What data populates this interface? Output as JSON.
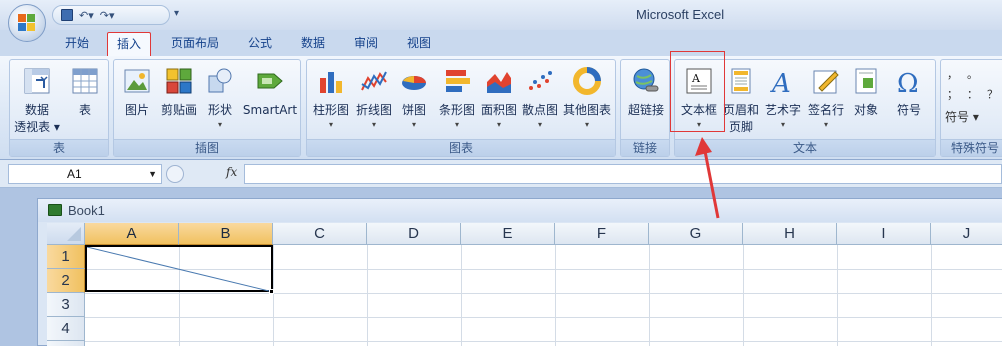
{
  "window": {
    "title": "Microsoft Excel"
  },
  "quick_access": {
    "dropdown_glyph": "▾"
  },
  "tabs": [
    {
      "label": "开始",
      "active": false
    },
    {
      "label": "插入",
      "active": true
    },
    {
      "label": "页面布局",
      "active": false
    },
    {
      "label": "公式",
      "active": false
    },
    {
      "label": "数据",
      "active": false
    },
    {
      "label": "审阅",
      "active": false
    },
    {
      "label": "视图",
      "active": false
    }
  ],
  "ribbon": {
    "groups": {
      "table": {
        "title": "表",
        "buttons": [
          {
            "label1": "数据",
            "label2": "透视表 ▾",
            "icon": "pivot-table-icon"
          },
          {
            "label1": "表",
            "label2": "",
            "icon": "table-icon"
          }
        ]
      },
      "illustrations": {
        "title": "插图",
        "buttons": [
          {
            "label1": "图片",
            "icon": "picture-icon"
          },
          {
            "label1": "剪贴画",
            "icon": "clipart-icon"
          },
          {
            "label1": "形状",
            "icon": "shapes-icon",
            "dropdown": true
          },
          {
            "label1": "SmartArt",
            "icon": "smartart-icon"
          }
        ]
      },
      "charts": {
        "title": "图表",
        "buttons": [
          {
            "label1": "柱形图",
            "icon": "column-chart-icon"
          },
          {
            "label1": "折线图",
            "icon": "line-chart-icon"
          },
          {
            "label1": "饼图",
            "icon": "pie-chart-icon"
          },
          {
            "label1": "条形图",
            "icon": "bar-chart-icon"
          },
          {
            "label1": "面积图",
            "icon": "area-chart-icon"
          },
          {
            "label1": "散点图",
            "icon": "scatter-chart-icon"
          },
          {
            "label1": "其他图表",
            "icon": "other-charts-icon"
          }
        ]
      },
      "links": {
        "title": "链接",
        "buttons": [
          {
            "label1": "超链接",
            "icon": "hyperlink-icon"
          }
        ]
      },
      "text": {
        "title": "文本",
        "buttons": [
          {
            "label1": "文本框",
            "icon": "textbox-icon",
            "dropdown": true
          },
          {
            "label1": "页眉和",
            "label2": "页脚",
            "icon": "header-footer-icon"
          },
          {
            "label1": "艺术字",
            "icon": "wordart-icon",
            "dropdown": true
          },
          {
            "label1": "签名行",
            "icon": "signature-line-icon",
            "dropdown": true
          },
          {
            "label1": "对象",
            "icon": "object-icon"
          },
          {
            "label1": "符号",
            "icon": "symbol-icon"
          }
        ]
      },
      "special_symbols": {
        "title": "特殊符号",
        "symbols": [
          "，",
          "。",
          "；",
          "：",
          "？"
        ],
        "button_label": "符号 ▾"
      }
    }
  },
  "formula_bar": {
    "cell_ref": "A1",
    "fx_label": "fx",
    "value": ""
  },
  "workbook": {
    "name": "Book1",
    "columns": [
      "A",
      "B",
      "C",
      "D",
      "E",
      "F",
      "G",
      "H",
      "I",
      "J"
    ],
    "rows": [
      "1",
      "2",
      "3",
      "4"
    ],
    "selected_columns": [
      "A",
      "B"
    ],
    "selected_rows": [
      "1",
      "2"
    ]
  },
  "colors": {
    "accent": "#15428b",
    "highlight": "#e03838",
    "selected_header": "#f1c15f"
  }
}
